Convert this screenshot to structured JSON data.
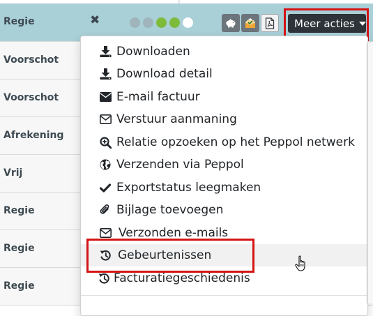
{
  "rows": [
    {
      "label": "Regie"
    },
    {
      "label": "Voorschot"
    },
    {
      "label": "Voorschot"
    },
    {
      "label": "Afrekening"
    },
    {
      "label": "Vrij"
    },
    {
      "label": "Regie"
    },
    {
      "label": "Regie"
    },
    {
      "label": "Regie"
    }
  ],
  "active_row": {
    "close_icon": "close-icon",
    "status_dots": [
      "#9fb5bb",
      "#9fb5bb",
      "#7dbb3a",
      "#7dbb3a",
      "#ffffff"
    ],
    "actions": [
      {
        "icon": "piggy-bank-icon"
      },
      {
        "icon": "invoice-check-icon"
      },
      {
        "icon": "pdf-icon"
      }
    ],
    "meer_acties_label": "Meer acties"
  },
  "menu": {
    "items": [
      {
        "label": "Downloaden",
        "icon": "download-icon"
      },
      {
        "label": "Download detail",
        "icon": "download-icon"
      },
      {
        "label": "E-mail factuur",
        "icon": "envelope-filled-icon"
      },
      {
        "label": "Verstuur aanmaning",
        "icon": "envelope-outline-icon"
      },
      {
        "label": "Relatie opzoeken op het Peppol netwerk",
        "icon": "search-plus-icon"
      },
      {
        "label": "Verzenden via Peppol",
        "icon": "globe-icon"
      },
      {
        "label": "Exportstatus leegmaken",
        "icon": "check-icon"
      },
      {
        "label": "Bijlage toevoegen",
        "icon": "paperclip-icon"
      },
      {
        "label": "Verzonden e-mails",
        "icon": "envelope-outline-icon"
      },
      {
        "label": "Gebeurtenissen",
        "icon": "history-icon"
      },
      {
        "label": "Facturatiegeschiedenis",
        "icon": "history-icon"
      }
    ],
    "hovered_item": "Gebeurtenissen"
  },
  "colors": {
    "active_row_bg": "#a9cfd7",
    "highlight_box": "#d41414",
    "primary_dark_button": "#2d3338"
  }
}
